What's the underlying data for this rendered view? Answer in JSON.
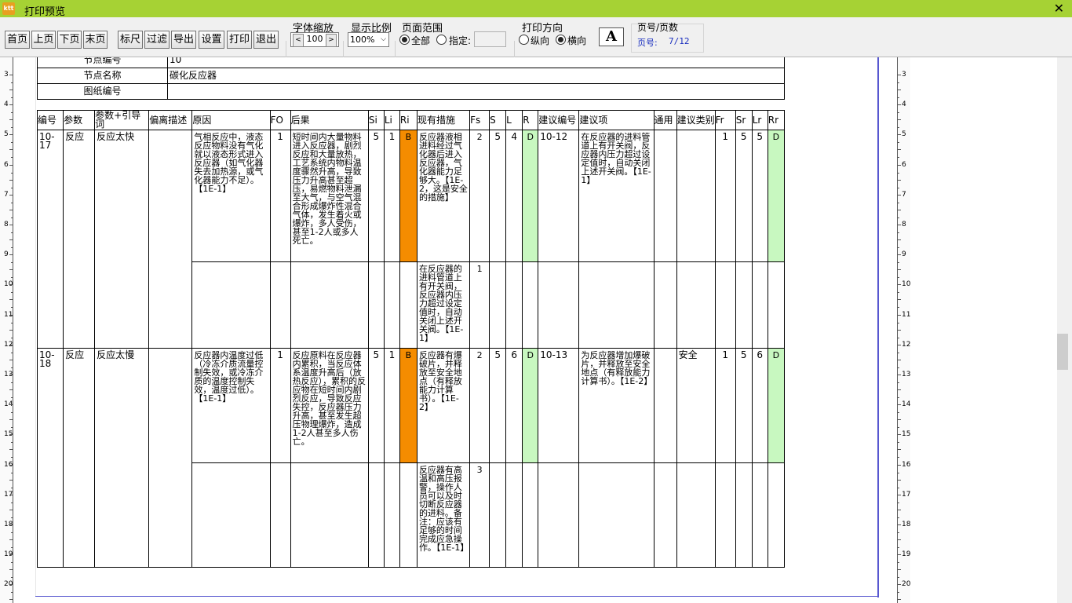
{
  "window": {
    "title": "打印预览",
    "icon_text": "ktt"
  },
  "toolbar": {
    "buttons": [
      "首页",
      "上页",
      "下页",
      "末页",
      "标尺",
      "过滤",
      "导出",
      "设置",
      "打印",
      "退出"
    ],
    "font_scale": {
      "label": "字体缩放",
      "value": "100"
    },
    "zoom": {
      "label": "显示比例",
      "value": "100%"
    },
    "page_range": {
      "label": "页面范围",
      "all": "全部",
      "specify": "指定:"
    },
    "orientation": {
      "label": "打印方向",
      "portrait": "纵向",
      "landscape": "横向"
    },
    "font_button": "A",
    "page_info": {
      "label": "页号/页数",
      "text": "页号:",
      "value": "7/12"
    }
  },
  "ruler": {
    "left_numbers": [
      "3",
      "4",
      "5",
      "6",
      "7",
      "8",
      "9",
      "10",
      "11",
      "12",
      "13",
      "14",
      "15",
      "16",
      "17",
      "18",
      "19",
      "20"
    ]
  },
  "node_info": [
    {
      "label": "节点编号",
      "value": "10"
    },
    {
      "label": "节点名称",
      "value": "碳化反应器"
    },
    {
      "label": "图纸编号",
      "value": ""
    }
  ],
  "hazop": {
    "headers": [
      "编号",
      "参数",
      "参数+引导词",
      "偏离描述",
      "原因",
      "FO",
      "后果",
      "Si",
      "Li",
      "Ri",
      "现有措施",
      "Fs",
      "S",
      "L",
      "R",
      "建议编号",
      "建议项",
      "通用",
      "建议类别",
      "Fr",
      "Sr",
      "Lr",
      "Rr"
    ],
    "rows": [
      {
        "id": "10-17",
        "param": "反应",
        "guideword": "反应太快",
        "deviation": "",
        "cause": "气相反应中，液态反应物料没有气化就以液态形式进入反应器（如气化器失去加热源，或气化器能力不足）。【1E-1】",
        "fo": "1",
        "consequence": "短时间内大量物料进入反应器，剧烈反应和大量放热，工艺系统内物料温度骤然升高，导致压力升高甚至超压，易燃物料泄漏至大气，与空气混合形成爆炸性混合气体，发生着火或爆炸，多人受伤，甚至1-2人或多人死亡。",
        "si": "5",
        "li": "1",
        "ri": "B",
        "measures": [
          {
            "text": "反应器液相进料经过气化器后进入反应器，气化器能力足够大。【1E-2，这是安全的措施】",
            "fs": "2"
          },
          {
            "text": "在反应器的进料管道上有开关阀，反应器内压力超过设定值时，自动关闭上述开关阀。【1E-1】",
            "fs": "1"
          }
        ],
        "s": "5",
        "l": "4",
        "r": "D",
        "rec_id": "10-12",
        "rec": "在反应器的进料管道上有开关阀，反应器内压力超过设定值时，自动关闭上述开关阀。【1E-1】",
        "general": "",
        "rec_type": "",
        "fr": "1",
        "sr": "5",
        "lr": "5",
        "rr": "D"
      },
      {
        "id": "10-18",
        "param": "反应",
        "guideword": "反应太慢",
        "deviation": "",
        "cause": "反应器内温度过低（冷冻介质流量控制失效，或冷冻介质的温度控制失效，温度过低）。【1E-1】",
        "fo": "1",
        "consequence": "反应原料在反应器内累积，当反应体系温度升高后（放热反应），累积的反应物在短时间内剧烈反应，导致反应失控，反应器压力升高，甚至发生超压物理爆炸，造成1-2人甚至多人伤亡。",
        "si": "5",
        "li": "1",
        "ri": "B",
        "measures": [
          {
            "text": "反应器有爆破片，并释放至安全地点（有释放能力计算书）。【1E-2】",
            "fs": "2"
          },
          {
            "text": "反应器有高温和高压报警，操作人员可以及时切断反应器的进料。备注：应该有足够的时间完成应急操作。【1E-1】",
            "fs": "3"
          }
        ],
        "s": "5",
        "l": "6",
        "r": "D",
        "rec_id": "10-13",
        "rec": "为反应器增加爆破片，并释放至安全地点（有释放能力计算书）。【1E-2】",
        "general": "",
        "rec_type": "安全",
        "fr": "1",
        "sr": "5",
        "lr": "6",
        "rr": "D"
      }
    ]
  },
  "colors": {
    "titlebar": "#a6d234",
    "risk_high": "#f58c00",
    "risk_ok": "#c8f8c0"
  }
}
